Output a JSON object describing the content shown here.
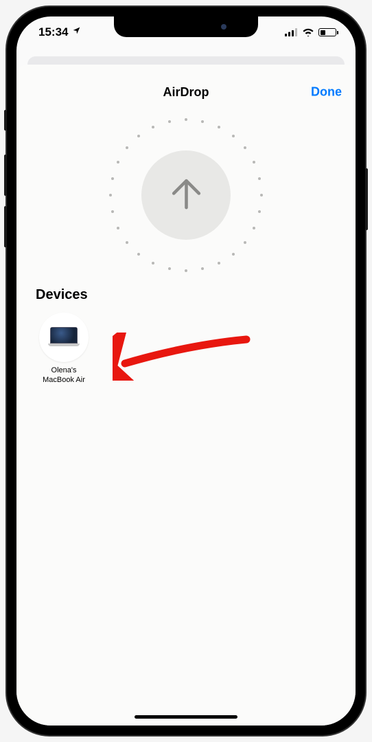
{
  "status": {
    "time": "15:34",
    "location_icon": "location-arrow"
  },
  "sheet": {
    "title": "AirDrop",
    "done_label": "Done"
  },
  "sections": {
    "devices_label": "Devices"
  },
  "devices": [
    {
      "name": "Olena's\nMacBook Air",
      "type": "macbook"
    }
  ],
  "battery_percent": 35,
  "colors": {
    "accent": "#007aff",
    "annotation": "#e8170f"
  }
}
